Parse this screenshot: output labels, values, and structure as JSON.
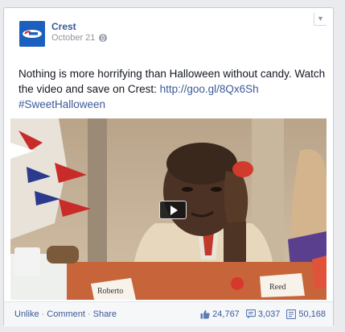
{
  "post": {
    "page_name": "Crest",
    "date": "October 21",
    "message_text": "Nothing is more horrifying than Halloween without candy. Watch the video and save on Crest: ",
    "link": "http://goo.gl/8Qx6Sh",
    "hashtag": "#SweetHalloween"
  },
  "video": {
    "place_cards": [
      "Roberto",
      "Reed"
    ]
  },
  "footer": {
    "unlike": "Unlike",
    "comment": "Comment",
    "share": "Share",
    "separator": "·",
    "likes": "24,767",
    "comments": "3,037",
    "shares": "50,168"
  },
  "colors": {
    "link": "#3b5998",
    "brand": "#1b5fbf"
  }
}
